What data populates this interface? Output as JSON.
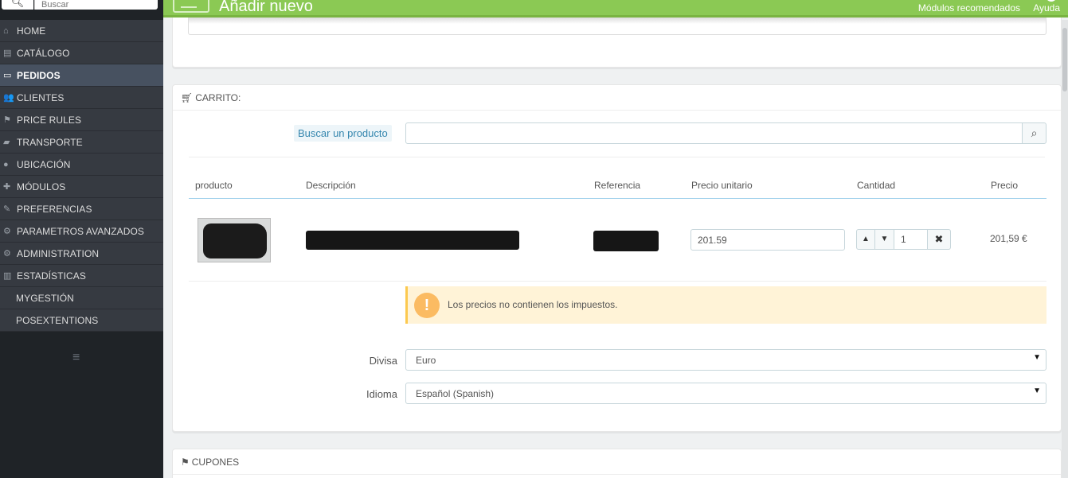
{
  "sidebar": {
    "search_placeholder": "Buscar",
    "items": [
      {
        "label": "HOME",
        "icon": "home-icon",
        "glyph": "⌂"
      },
      {
        "label": "CATÁLOGO",
        "icon": "book-icon",
        "glyph": "▤"
      },
      {
        "label": "PEDIDOS",
        "icon": "credit-card-icon",
        "glyph": "▭",
        "active": true
      },
      {
        "label": "CLIENTES",
        "icon": "users-icon",
        "glyph": "👥"
      },
      {
        "label": "PRICE RULES",
        "icon": "tags-icon",
        "glyph": "⚑"
      },
      {
        "label": "TRANSPORTE",
        "icon": "truck-icon",
        "glyph": "▰"
      },
      {
        "label": "UBICACIÓN",
        "icon": "globe-icon",
        "glyph": "●"
      },
      {
        "label": "MÓDULOS",
        "icon": "puzzle-icon",
        "glyph": "✚"
      },
      {
        "label": "PREFERENCIAS",
        "icon": "wrench-icon",
        "glyph": "✎"
      },
      {
        "label": "PARAMETROS AVANZADOS",
        "icon": "cogs-icon",
        "glyph": "⚙"
      },
      {
        "label": "ADMINISTRATION",
        "icon": "cog-icon",
        "glyph": "⚙"
      },
      {
        "label": "ESTADÍSTICAS",
        "icon": "bar-chart-icon",
        "glyph": "▥"
      },
      {
        "label": "MYGESTIÓN",
        "icon": "",
        "glyph": ""
      },
      {
        "label": "POSEXTENTIONS",
        "icon": "",
        "glyph": ""
      }
    ]
  },
  "header": {
    "title": "Añadir nuevo",
    "recommended": "Módulos recomendados",
    "help": "Ayuda"
  },
  "cart": {
    "heading": "CARRITO:",
    "search_label": "Buscar un producto",
    "columns": {
      "product": "producto",
      "description": "Descripción",
      "reference": "Referencia",
      "unit_price": "Precio unitario",
      "quantity": "Cantidad",
      "price": "Precio"
    },
    "row": {
      "unit_price": "201.59",
      "quantity": "1",
      "total": "201,59 €"
    },
    "alert": "Los precios no contienen los impuestos.",
    "currency_label": "Divisa",
    "currency_value": "Euro",
    "language_label": "Idioma",
    "language_value": "Español (Spanish)"
  },
  "coupons": {
    "heading": "CUPONES"
  },
  "colors": {
    "header_green": "#8bc954",
    "sidebar_bg": "#363a41",
    "sidebar_active": "#475160",
    "alert_bg": "#fff3d7",
    "alert_icon": "#fbbb62"
  }
}
